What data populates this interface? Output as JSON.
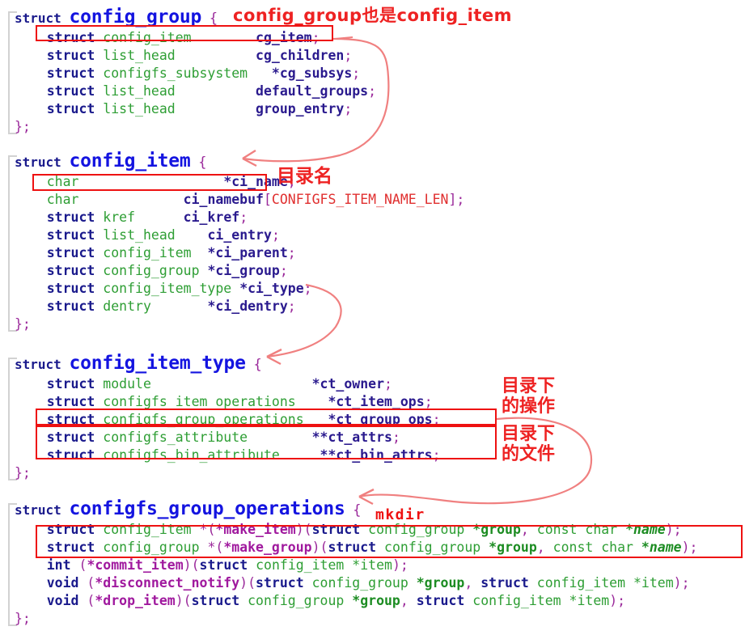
{
  "document": {
    "title": "configfs struct definitions with annotations",
    "language": "c"
  },
  "colors": {
    "keyword": "#1a1a8c",
    "type": "#2e9e34",
    "member": "#2a1a8e",
    "function": "#a0199e",
    "punctuation": "#9b2a9b",
    "macro": "#e03030",
    "struct_name": "#1414e0",
    "annotation_red": "#ee2222",
    "fold_bar": "#d2d2d2"
  },
  "blocks": [
    {
      "id": "config_group",
      "keyword": "struct",
      "name": "config_group",
      "brace": "{",
      "lines": [
        {
          "indent": "    ",
          "parts": [
            {
              "t": "struct ",
              "c": "kw"
            },
            {
              "t": "config_item",
              "c": "type"
            },
            {
              "t": "        ",
              "c": "plain"
            },
            {
              "t": "cg_item",
              "c": "member"
            },
            {
              "t": ";",
              "c": "semi"
            }
          ]
        },
        {
          "indent": "    ",
          "parts": [
            {
              "t": "struct ",
              "c": "kw"
            },
            {
              "t": "list_head",
              "c": "type"
            },
            {
              "t": "          ",
              "c": "plain"
            },
            {
              "t": "cg_children",
              "c": "member"
            },
            {
              "t": ";",
              "c": "semi"
            }
          ]
        },
        {
          "indent": "    ",
          "parts": [
            {
              "t": "struct ",
              "c": "kw"
            },
            {
              "t": "configfs_subsystem",
              "c": "type"
            },
            {
              "t": "   ",
              "c": "plain"
            },
            {
              "t": "*cg_subsys",
              "c": "member"
            },
            {
              "t": ";",
              "c": "semi"
            }
          ]
        },
        {
          "indent": "    ",
          "parts": [
            {
              "t": "struct ",
              "c": "kw"
            },
            {
              "t": "list_head",
              "c": "type"
            },
            {
              "t": "          ",
              "c": "plain"
            },
            {
              "t": "default_groups",
              "c": "member"
            },
            {
              "t": ";",
              "c": "semi"
            }
          ]
        },
        {
          "indent": "    ",
          "parts": [
            {
              "t": "struct ",
              "c": "kw"
            },
            {
              "t": "list_head",
              "c": "type"
            },
            {
              "t": "          ",
              "c": "plain"
            },
            {
              "t": "group_entry",
              "c": "member"
            },
            {
              "t": ";",
              "c": "semi"
            }
          ]
        }
      ],
      "closer": "};"
    },
    {
      "id": "config_item",
      "keyword": "struct",
      "name": "config_item",
      "brace": "{",
      "lines": [
        {
          "indent": "    ",
          "parts": [
            {
              "t": "char",
              "c": "type"
            },
            {
              "t": "                  ",
              "c": "plain"
            },
            {
              "t": "*ci_name",
              "c": "member"
            },
            {
              "t": ";",
              "c": "semi"
            }
          ]
        },
        {
          "indent": "    ",
          "parts": [
            {
              "t": "char",
              "c": "type"
            },
            {
              "t": "             ",
              "c": "plain"
            },
            {
              "t": "ci_namebuf",
              "c": "member"
            },
            {
              "t": "[",
              "c": "punc"
            },
            {
              "t": "CONFIGFS_ITEM_NAME_LEN",
              "c": "macro"
            },
            {
              "t": "]",
              "c": "punc"
            },
            {
              "t": ";",
              "c": "semi"
            }
          ]
        },
        {
          "indent": "    ",
          "parts": [
            {
              "t": "struct ",
              "c": "kw"
            },
            {
              "t": "kref",
              "c": "type"
            },
            {
              "t": "      ",
              "c": "plain"
            },
            {
              "t": "ci_kref",
              "c": "member"
            },
            {
              "t": ";",
              "c": "semi"
            }
          ]
        },
        {
          "indent": "    ",
          "parts": [
            {
              "t": "struct ",
              "c": "kw"
            },
            {
              "t": "list_head",
              "c": "type"
            },
            {
              "t": "    ",
              "c": "plain"
            },
            {
              "t": "ci_entry",
              "c": "member"
            },
            {
              "t": ";",
              "c": "semi"
            }
          ]
        },
        {
          "indent": "    ",
          "parts": [
            {
              "t": "struct ",
              "c": "kw"
            },
            {
              "t": "config_item",
              "c": "type"
            },
            {
              "t": "  ",
              "c": "plain"
            },
            {
              "t": "*ci_parent",
              "c": "member"
            },
            {
              "t": ";",
              "c": "semi"
            }
          ]
        },
        {
          "indent": "    ",
          "parts": [
            {
              "t": "struct ",
              "c": "kw"
            },
            {
              "t": "config_group",
              "c": "type"
            },
            {
              "t": " ",
              "c": "plain"
            },
            {
              "t": "*ci_group",
              "c": "member"
            },
            {
              "t": ";",
              "c": "semi"
            }
          ]
        },
        {
          "indent": "    ",
          "parts": [
            {
              "t": "struct ",
              "c": "kw"
            },
            {
              "t": "config_item_type",
              "c": "type"
            },
            {
              "t": " ",
              "c": "plain"
            },
            {
              "t": "*ci_type",
              "c": "member"
            },
            {
              "t": ";",
              "c": "semi"
            }
          ]
        },
        {
          "indent": "    ",
          "parts": [
            {
              "t": "struct ",
              "c": "kw"
            },
            {
              "t": "dentry",
              "c": "type"
            },
            {
              "t": "       ",
              "c": "plain"
            },
            {
              "t": "*ci_dentry",
              "c": "member"
            },
            {
              "t": ";",
              "c": "semi"
            }
          ]
        }
      ],
      "closer": "};"
    },
    {
      "id": "config_item_type",
      "keyword": "struct",
      "name": "config_item_type",
      "brace": "{",
      "lines": [
        {
          "indent": "    ",
          "parts": [
            {
              "t": "struct ",
              "c": "kw"
            },
            {
              "t": "module",
              "c": "type"
            },
            {
              "t": "                    ",
              "c": "plain"
            },
            {
              "t": "*ct_owner",
              "c": "member"
            },
            {
              "t": ";",
              "c": "semi"
            }
          ]
        },
        {
          "indent": "    ",
          "parts": [
            {
              "t": "struct ",
              "c": "kw"
            },
            {
              "t": "configfs_item_operations",
              "c": "type"
            },
            {
              "t": "    ",
              "c": "plain"
            },
            {
              "t": "*ct_item_ops",
              "c": "member"
            },
            {
              "t": ";",
              "c": "semi"
            }
          ]
        },
        {
          "indent": "    ",
          "parts": [
            {
              "t": "struct ",
              "c": "kw"
            },
            {
              "t": "configfs_group_operations",
              "c": "type"
            },
            {
              "t": "   ",
              "c": "plain"
            },
            {
              "t": "*ct_group_ops",
              "c": "member"
            },
            {
              "t": ";",
              "c": "semi"
            }
          ]
        },
        {
          "indent": "    ",
          "parts": [
            {
              "t": "struct ",
              "c": "kw"
            },
            {
              "t": "configfs_attribute",
              "c": "type"
            },
            {
              "t": "        ",
              "c": "plain"
            },
            {
              "t": "**ct_attrs",
              "c": "member"
            },
            {
              "t": ";",
              "c": "semi"
            }
          ]
        },
        {
          "indent": "    ",
          "parts": [
            {
              "t": "struct ",
              "c": "kw"
            },
            {
              "t": "configfs_bin_attribute",
              "c": "type"
            },
            {
              "t": "     ",
              "c": "plain"
            },
            {
              "t": "**ct_bin_attrs",
              "c": "member"
            },
            {
              "t": ";",
              "c": "semi"
            }
          ]
        }
      ],
      "closer": "};"
    },
    {
      "id": "configfs_group_operations",
      "keyword": "struct",
      "name": "configfs_group_operations",
      "brace": "{",
      "lines": [
        {
          "indent": "    ",
          "parts": [
            {
              "t": "struct ",
              "c": "kw"
            },
            {
              "t": "config_item ",
              "c": "type"
            },
            {
              "t": "*(",
              "c": "punc"
            },
            {
              "t": "*make_item",
              "c": "fn"
            },
            {
              "t": ")(",
              "c": "punc"
            },
            {
              "t": "struct ",
              "c": "kw"
            },
            {
              "t": "config_group ",
              "c": "type"
            },
            {
              "t": "*group",
              "c": "typeb"
            },
            {
              "t": ", ",
              "c": "punc"
            },
            {
              "t": "const char ",
              "c": "type"
            },
            {
              "t": "*name",
              "c": "italic"
            },
            {
              "t": ")",
              "c": "punc"
            },
            {
              "t": ";",
              "c": "semi"
            }
          ]
        },
        {
          "indent": "    ",
          "parts": [
            {
              "t": "struct ",
              "c": "kw"
            },
            {
              "t": "config_group ",
              "c": "type"
            },
            {
              "t": "*(",
              "c": "punc"
            },
            {
              "t": "*make_group",
              "c": "fn"
            },
            {
              "t": ")(",
              "c": "punc"
            },
            {
              "t": "struct ",
              "c": "kw"
            },
            {
              "t": "config_group ",
              "c": "type"
            },
            {
              "t": "*group",
              "c": "typeb"
            },
            {
              "t": ", ",
              "c": "punc"
            },
            {
              "t": "const char ",
              "c": "type"
            },
            {
              "t": "*name",
              "c": "italic"
            },
            {
              "t": ")",
              "c": "punc"
            },
            {
              "t": ";",
              "c": "semi"
            }
          ]
        },
        {
          "indent": "    ",
          "parts": [
            {
              "t": "int ",
              "c": "kw"
            },
            {
              "t": "(",
              "c": "punc"
            },
            {
              "t": "*commit_item",
              "c": "fn"
            },
            {
              "t": ")(",
              "c": "punc"
            },
            {
              "t": "struct ",
              "c": "kw"
            },
            {
              "t": "config_item ",
              "c": "type"
            },
            {
              "t": "*item",
              "c": "type"
            },
            {
              "t": ")",
              "c": "punc"
            },
            {
              "t": ";",
              "c": "semi"
            }
          ]
        },
        {
          "indent": "    ",
          "parts": [
            {
              "t": "void ",
              "c": "kw"
            },
            {
              "t": "(",
              "c": "punc"
            },
            {
              "t": "*disconnect_notify",
              "c": "fn"
            },
            {
              "t": ")(",
              "c": "punc"
            },
            {
              "t": "struct ",
              "c": "kw"
            },
            {
              "t": "config_group ",
              "c": "type"
            },
            {
              "t": "*group",
              "c": "typeb"
            },
            {
              "t": ", ",
              "c": "punc"
            },
            {
              "t": "struct ",
              "c": "kw"
            },
            {
              "t": "config_item ",
              "c": "type"
            },
            {
              "t": "*item",
              "c": "type"
            },
            {
              "t": ")",
              "c": "punc"
            },
            {
              "t": ";",
              "c": "semi"
            }
          ]
        },
        {
          "indent": "    ",
          "parts": [
            {
              "t": "void ",
              "c": "kw"
            },
            {
              "t": "(",
              "c": "punc"
            },
            {
              "t": "*drop_item",
              "c": "fn"
            },
            {
              "t": ")(",
              "c": "punc"
            },
            {
              "t": "struct ",
              "c": "kw"
            },
            {
              "t": "config_group ",
              "c": "type"
            },
            {
              "t": "*group",
              "c": "typeb"
            },
            {
              "t": ", ",
              "c": "punc"
            },
            {
              "t": "struct ",
              "c": "kw"
            },
            {
              "t": "config_item ",
              "c": "type"
            },
            {
              "t": "*item",
              "c": "type"
            },
            {
              "t": ")",
              "c": "punc"
            },
            {
              "t": ";",
              "c": "semi"
            }
          ]
        }
      ],
      "closer": "};"
    }
  ],
  "annotations": {
    "config_group_is_config_item": "config_group也是config_item",
    "directory_name": "目录名",
    "operations_under_directory": "目录下\n的操作",
    "files_under_directory": "目录下\n的文件",
    "mkdir": "mkdir"
  }
}
